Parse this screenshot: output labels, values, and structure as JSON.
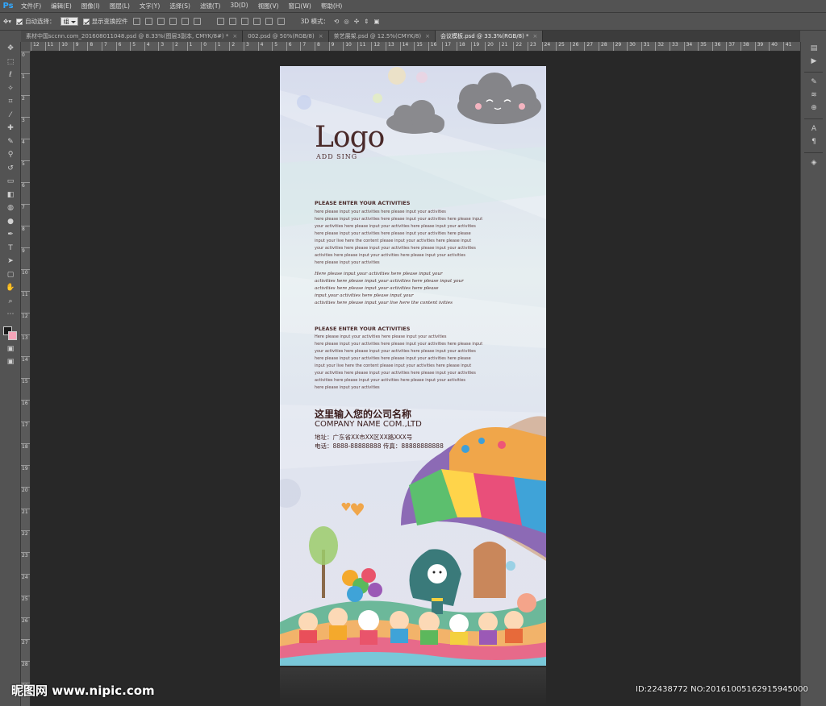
{
  "app": {
    "logo_text": "Ps"
  },
  "menu": [
    "文件(F)",
    "编辑(E)",
    "图像(I)",
    "图层(L)",
    "文字(Y)",
    "选择(S)",
    "滤镜(T)",
    "3D(D)",
    "视图(V)",
    "窗口(W)",
    "帮助(H)"
  ],
  "options": {
    "auto_select_label": "自动选择：",
    "auto_select_value": "组",
    "show_transform_label": "显示变换控件",
    "mode_3d_label": "3D 模式："
  },
  "tabs": [
    {
      "label": "素材中国sccnn.com_201608011048.psd @ 8.33%(图层3副本, CMYK/8#) *",
      "active": false
    },
    {
      "label": "002.psd @ 50%(RGB/8)",
      "active": false
    },
    {
      "label": "茶艺展架.psd @ 12.5%(CMYK/8)",
      "active": false
    },
    {
      "label": "会议模板.psd @ 33.3%(RGB/8) *",
      "active": true
    }
  ],
  "ruler_h": [
    "12",
    "11",
    "10",
    "9",
    "8",
    "7",
    "6",
    "5",
    "4",
    "3",
    "2",
    "1",
    "0",
    "1",
    "2",
    "3",
    "4",
    "5",
    "6",
    "7",
    "8",
    "9",
    "10",
    "11",
    "12",
    "13",
    "14",
    "15",
    "16",
    "17",
    "18",
    "19",
    "20",
    "21",
    "22",
    "23",
    "24",
    "25",
    "26",
    "27",
    "28",
    "29",
    "30",
    "31",
    "32",
    "33",
    "34",
    "35",
    "36",
    "37",
    "38",
    "39",
    "40",
    "41"
  ],
  "ruler_v": [
    "0",
    "1",
    "2",
    "3",
    "4",
    "5",
    "6",
    "7",
    "8",
    "9",
    "10",
    "11",
    "12",
    "13",
    "14",
    "15",
    "16",
    "17",
    "18",
    "19",
    "20",
    "21",
    "22",
    "23",
    "24",
    "25",
    "26",
    "27",
    "28",
    "29"
  ],
  "poster": {
    "logo": "Logo",
    "logo_sub": "ADD SING",
    "section1_title": "PLEASE ENTER YOUR ACTIVITIES",
    "section1_lines": [
      "here please input your activities here please input your activities",
      "here please input your activities here please input your activities here please input",
      "your activities here please input your activities here please input your activities",
      "here please input your activities here please input your activities here please",
      "input your live here the content please input your activities here please input",
      "your activities here please input your activities here please input your activities",
      "activities here please input your activities here please input your activities",
      "here please input your activities"
    ],
    "script_lines": [
      "Here please input your activities here please input your",
      "activities here please input your activities here please input your",
      "activities here please input your activities here please",
      "input your activities here please input your",
      "activities here please input your live here the content ivities"
    ],
    "section2_title": "PLEASE ENTER YOUR ACTIVITIES",
    "section2_lines": [
      "Here please input your activities here please input your activities",
      "here please input your activities here please input your activities here please input",
      "your activities here please input your activities here please input your activities",
      "here please input your activities here please input your activities here please",
      "input your live here the content please input your activities here please input",
      "your activities here please input your activities here please input your activities",
      "activities here please input your activities here please input your activities",
      "here please input your activities"
    ],
    "company_cn": "这里输入您的公司名称",
    "company_en": "COMPANY NAME COM.,LTD",
    "address": "地址：广东省XX市XX区XX路XXX号",
    "phone": "电话：8888-88888888  传真：88888888888"
  },
  "watermark": {
    "left": "昵图网 www.nipic.com",
    "right": "ID:22438772 NO:20161005162915945000"
  },
  "colors": {
    "accent": "#31a8ff",
    "ui_bg": "#535353",
    "canvas_bg": "#282828"
  }
}
